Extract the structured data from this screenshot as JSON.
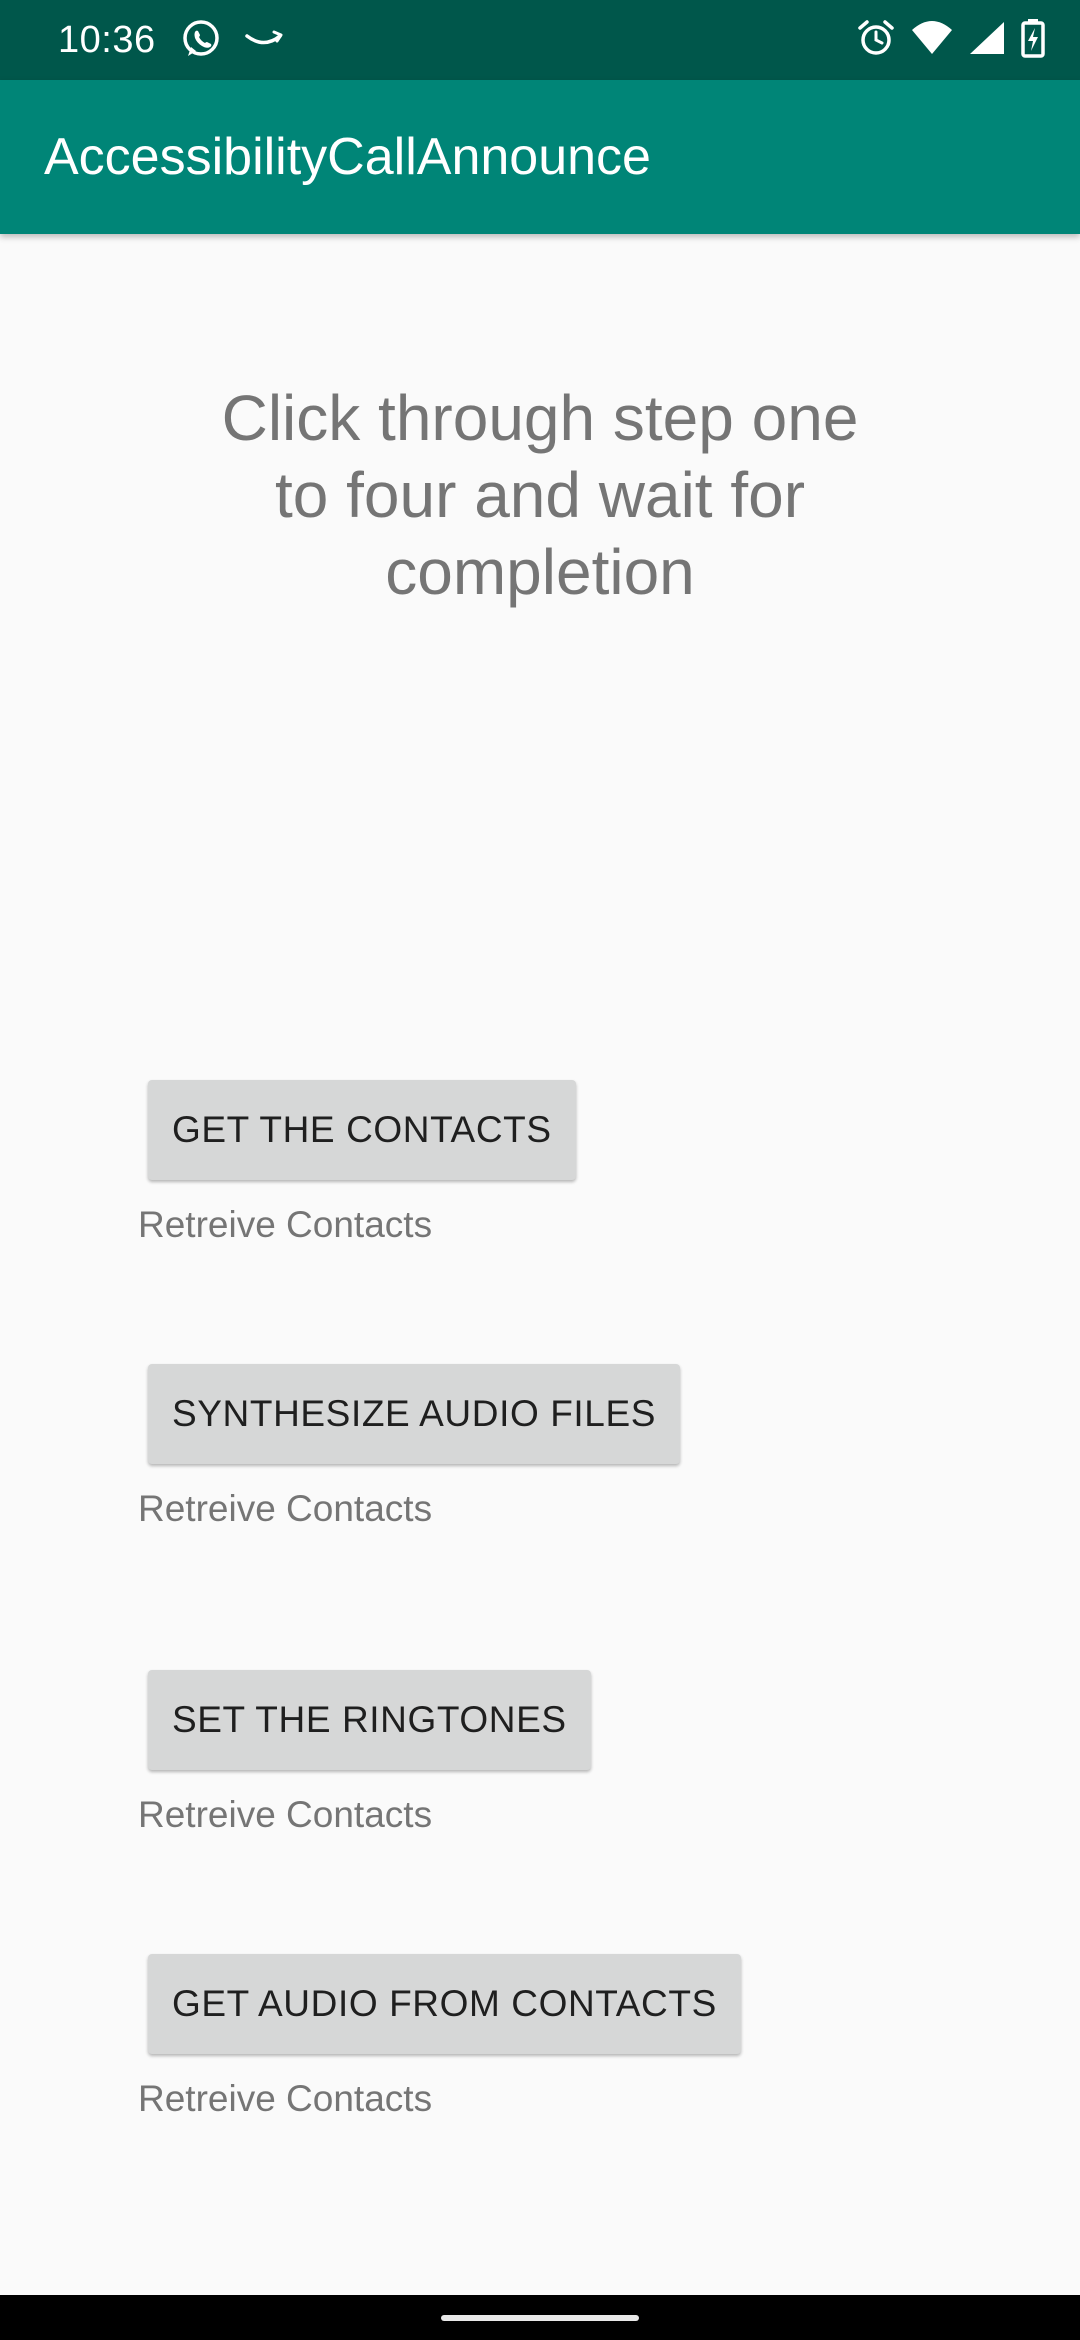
{
  "status_bar": {
    "time": "10:36",
    "left_icons": [
      "whatsapp-icon",
      "amazon-icon"
    ],
    "right_icons": [
      "alarm-icon",
      "wifi-icon",
      "signal-icon",
      "battery-charging-icon"
    ]
  },
  "app_bar": {
    "title": "AccessibilityCallAnnounce",
    "color": "#008577"
  },
  "main": {
    "instruction": "Click through step one to four and wait for completion",
    "steps": [
      {
        "button_label": "GET THE CONTACTS",
        "status": "Retreive Contacts"
      },
      {
        "button_label": "SYNTHESIZE AUDIO FILES",
        "status": "Retreive Contacts"
      },
      {
        "button_label": "SET THE RINGTONES",
        "status": "Retreive Contacts"
      },
      {
        "button_label": "GET AUDIO FROM CONTACTS",
        "status": "Retreive Contacts"
      }
    ]
  },
  "colors": {
    "status_bar": "#00574b",
    "button": "#d6d7d7",
    "text_secondary": "#757575"
  }
}
